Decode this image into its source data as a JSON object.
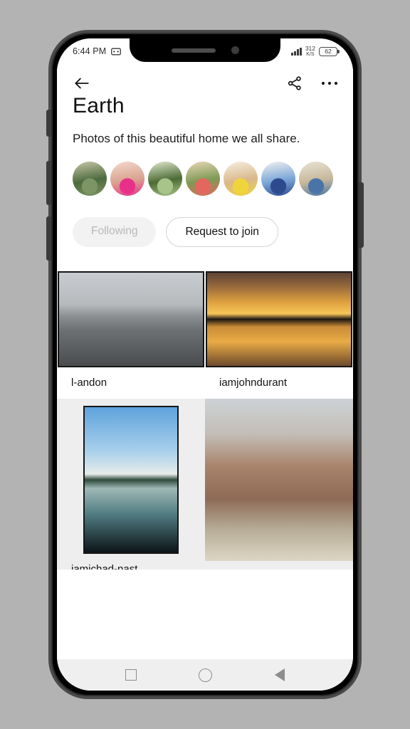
{
  "status_bar": {
    "time": "6:44 PM",
    "notification_icon": "message-icon",
    "network_speed_value": "312",
    "network_speed_unit": "K/S",
    "battery_level": "62",
    "signal_icon": "signal-bars-icon"
  },
  "toolbar": {
    "back_icon": "back-arrow-icon",
    "share_icon": "share-icon",
    "overflow_icon": "overflow-menu-icon"
  },
  "header": {
    "title": "Earth",
    "description": "Photos of this beautiful home we all share."
  },
  "members": [
    {
      "name": "member-avatar-1",
      "colors": [
        "#7d9464",
        "#4d6b3e",
        "#c8c6a8"
      ]
    },
    {
      "name": "member-avatar-2",
      "colors": [
        "#e8308a",
        "#d9a38e",
        "#f3d9cf"
      ]
    },
    {
      "name": "member-avatar-3",
      "colors": [
        "#a9c489",
        "#4c6b34",
        "#dfe8cd"
      ]
    },
    {
      "name": "member-avatar-4",
      "colors": [
        "#e2685f",
        "#7e9a54",
        "#e8d7b6"
      ]
    },
    {
      "name": "member-avatar-5",
      "colors": [
        "#f0d43c",
        "#d9b88a",
        "#f6efe2"
      ]
    },
    {
      "name": "member-avatar-6",
      "colors": [
        "#2e4a8f",
        "#7aa6d6",
        "#f2f2f2"
      ]
    },
    {
      "name": "member-avatar-7",
      "colors": [
        "#4a74a8",
        "#c7b89a",
        "#e9e3d6"
      ]
    }
  ],
  "actions": {
    "following_label": "Following",
    "request_to_join_label": "Request to join"
  },
  "photo_grid": {
    "rows": [
      {
        "cells": [
          {
            "name": "photo-cell-landon",
            "caption": "l-andon",
            "layout": "landscape",
            "image_desc": "black-and-white-forest-road-photo"
          },
          {
            "name": "photo-cell-iamjohndurant",
            "caption": "iamjohndurant",
            "layout": "landscape",
            "image_desc": "golden-sunset-lake-photo"
          }
        ]
      },
      {
        "cells": [
          {
            "name": "photo-cell-iamichad",
            "caption": "iamichad-nast",
            "layout": "portrait",
            "image_desc": "island-reflection-calm-water-photo"
          },
          {
            "name": "photo-cell-mountains",
            "caption": "",
            "layout": "full",
            "image_desc": "tre-cime-rocky-mountain-peaks-photo"
          }
        ]
      }
    ]
  },
  "nav_bar": {
    "recents_icon": "square-recents-icon",
    "home_icon": "circle-home-icon",
    "back_icon": "triangle-back-icon"
  },
  "theme": {
    "accent": "#111111",
    "muted_text": "#b8b8b8",
    "surface": "#ffffff",
    "row_alt_surface": "#eeeeee",
    "nav_surface": "#efefef"
  }
}
